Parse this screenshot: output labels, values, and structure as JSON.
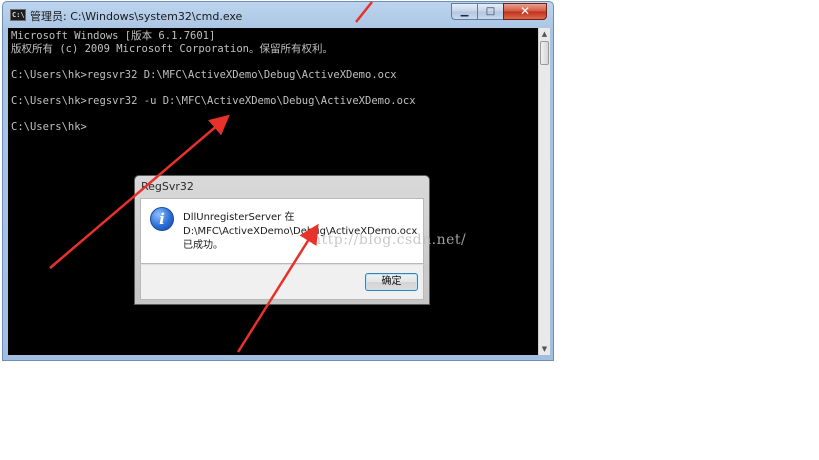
{
  "window": {
    "icon_glyph": "C:\\",
    "title": "管理员: C:\\Windows\\system32\\cmd.exe",
    "controls": {
      "minimize": "▁",
      "maximize": "□",
      "close": "✕"
    }
  },
  "console": {
    "lines": [
      "Microsoft Windows [版本 6.1.7601]",
      "版权所有 (c) 2009 Microsoft Corporation。保留所有权利。",
      "",
      "C:\\Users\\hk>regsvr32 D:\\MFC\\ActiveXDemo\\Debug\\ActiveXDemo.ocx",
      "",
      "C:\\Users\\hk>regsvr32 -u D:\\MFC\\ActiveXDemo\\Debug\\ActiveXDemo.ocx",
      "",
      "C:\\Users\\hk>"
    ],
    "text_color": "#c0c0c0",
    "background": "#000000"
  },
  "scrollbar": {
    "up": "▲",
    "down": "▼"
  },
  "dialog": {
    "title": "RegSvr32",
    "icon": "info-icon",
    "message_lines": [
      "DllUnregisterServer 在",
      "D:\\MFC\\ActiveXDemo\\Debug\\ActiveXDemo.ocx",
      "已成功。"
    ],
    "ok_label": "确定"
  },
  "watermark": "http://blog.csdn.net/",
  "annotation_color": "#e8312a"
}
